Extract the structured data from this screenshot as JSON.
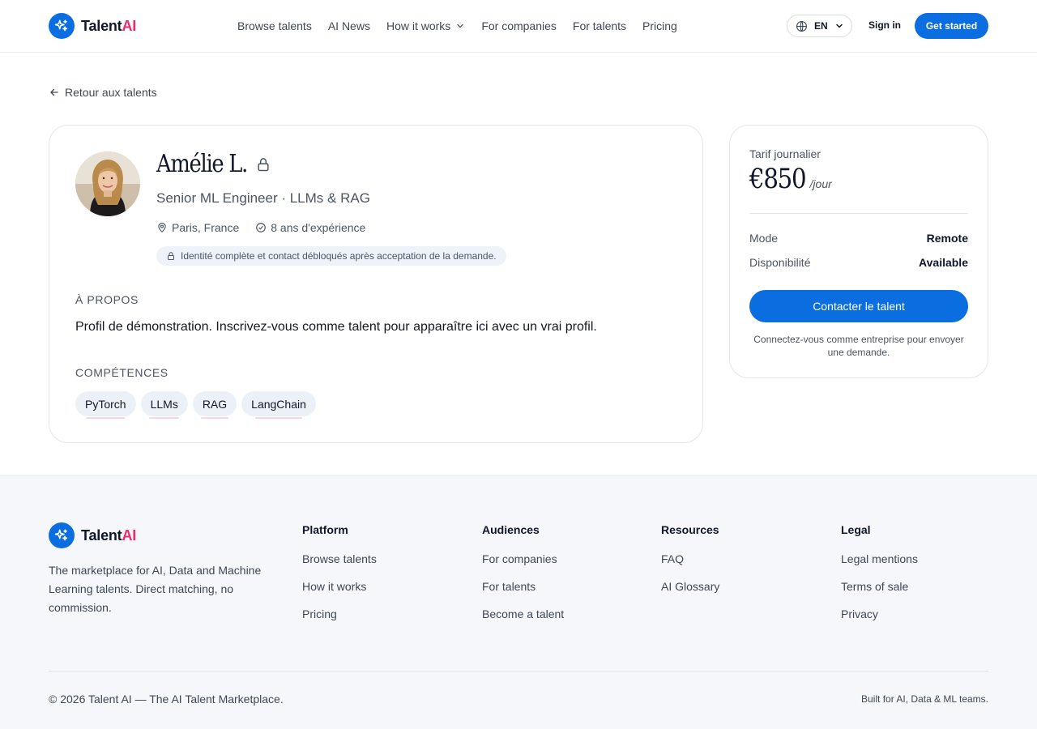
{
  "brand": {
    "name_prefix": "Talent",
    "name_suffix": "AI",
    "accent": "#0b6ee0",
    "ai_color": "#ef2b6b"
  },
  "header": {
    "nav": [
      {
        "label": "Browse talents"
      },
      {
        "label": "AI News"
      },
      {
        "label": "How it works",
        "has_dropdown": true
      },
      {
        "label": "For companies"
      },
      {
        "label": "For talents"
      },
      {
        "label": "Pricing"
      }
    ],
    "language": "EN",
    "sign_in": "Sign in",
    "get_started": "Get started"
  },
  "back_link": "Retour aux talents",
  "profile": {
    "name": "Amélie L.",
    "title": "Senior ML Engineer · LLMs & RAG",
    "location": "Paris, France",
    "experience": "8 ans d'expérience",
    "identity_notice": "Identité complète et contact débloqués après acceptation de la demande.",
    "about_heading": "À propos",
    "about_text": "Profil de démonstration. Inscrivez-vous comme talent pour apparaître ici avec un vrai profil.",
    "skills_heading": "Compétences",
    "skills": [
      "PyTorch",
      "LLMs",
      "RAG",
      "LangChain"
    ]
  },
  "rate": {
    "label": "Tarif journalier",
    "amount": "€850",
    "unit": "/jour",
    "mode_label": "Mode",
    "mode_value": "Remote",
    "availability_label": "Disponibilité",
    "availability_value": "Available",
    "contact_button": "Contacter le talent",
    "note": "Connectez-vous comme entreprise pour envoyer une demande."
  },
  "footer": {
    "tagline": "The marketplace for AI, Data and Machine Learning talents. Direct matching, no commission.",
    "columns": [
      {
        "title": "Platform",
        "links": [
          "Browse talents",
          "How it works",
          "Pricing"
        ]
      },
      {
        "title": "Audiences",
        "links": [
          "For companies",
          "For talents",
          "Become a talent"
        ]
      },
      {
        "title": "Resources",
        "links": [
          "FAQ",
          "AI Glossary"
        ]
      },
      {
        "title": "Legal",
        "links": [
          "Legal mentions",
          "Terms of sale",
          "Privacy"
        ]
      }
    ],
    "copyright": "© 2026 Talent AI — The AI Talent Marketplace.",
    "built_for": "Built for AI, Data & ML teams."
  }
}
